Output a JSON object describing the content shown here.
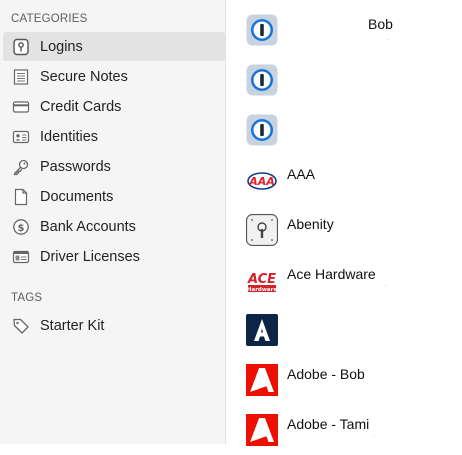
{
  "sidebar": {
    "categories_header": "CATEGORIES",
    "categories": [
      {
        "label": "Logins",
        "icon": "key-lock-icon",
        "selected": true
      },
      {
        "label": "Secure Notes",
        "icon": "note-icon"
      },
      {
        "label": "Credit Cards",
        "icon": "credit-card-icon"
      },
      {
        "label": "Identities",
        "icon": "identity-card-icon"
      },
      {
        "label": "Passwords",
        "icon": "key-icon"
      },
      {
        "label": "Documents",
        "icon": "document-icon"
      },
      {
        "label": "Bank Accounts",
        "icon": "dollar-coin-icon"
      },
      {
        "label": "Driver Licenses",
        "icon": "license-card-icon"
      }
    ],
    "tags_header": "TAGS",
    "tags": [
      {
        "label": "Starter Kit",
        "icon": "tag-icon"
      }
    ]
  },
  "list": {
    "items": [
      {
        "title": "Bob",
        "icon": "onepassword-icon"
      },
      {
        "title": "",
        "icon": "onepassword-icon"
      },
      {
        "title": "",
        "icon": "onepassword-icon"
      },
      {
        "title": "AAA",
        "icon": "aaa-logo-icon"
      },
      {
        "title": "Abenity",
        "icon": "keyhole-icon"
      },
      {
        "title": "Ace Hardware",
        "icon": "ace-hardware-logo-icon"
      },
      {
        "title": "",
        "icon": "letter-a-logo-icon"
      },
      {
        "title": "Adobe - Bob",
        "icon": "adobe-logo-icon"
      },
      {
        "title": "Adobe - Tami",
        "icon": "adobe-logo-icon"
      }
    ]
  },
  "colors": {
    "sidebar_bg": "#f5f5f5",
    "selected_bg": "#e3e3e3",
    "onepassword_blue": "#1a74d6",
    "aaa_red": "#e21f26",
    "aaa_blue": "#0a3b8f",
    "ace_red": "#d2232a",
    "adobe_red": "#eb1000",
    "dark_navy": "#0c2445"
  }
}
